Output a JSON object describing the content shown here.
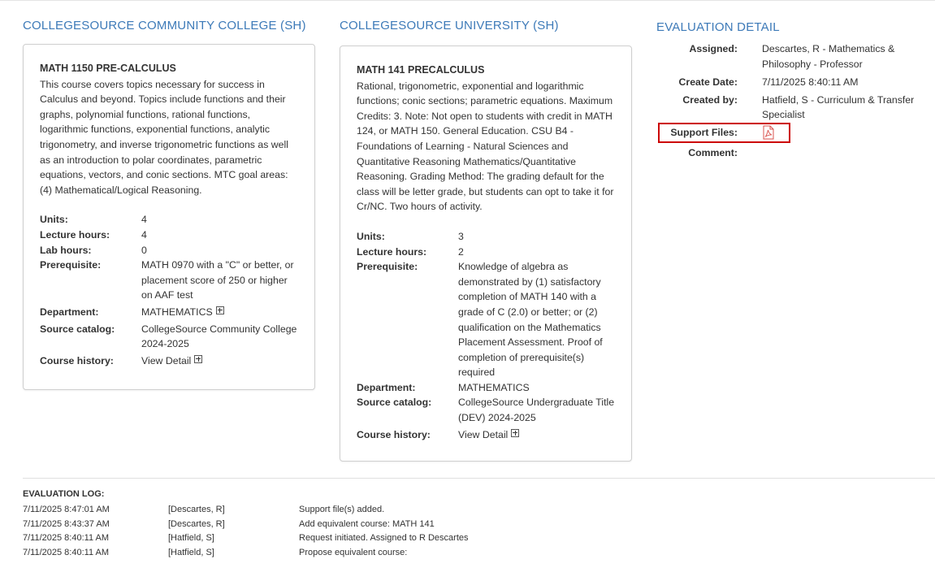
{
  "left_course": {
    "institution": "COLLEGESOURCE COMMUNITY COLLEGE (SH)",
    "title": "MATH 1150 PRE-CALCULUS",
    "description": "This course covers topics necessary for success in Calculus and beyond. Topics include functions and their graphs, polynomial functions, rational functions, logarithmic functions, exponential functions, analytic trigonometry, and inverse trigonometric functions as well as an introduction to polar coordinates, parametric equations, vectors, and conic sections. MTC goal areas: (4) Mathematical/Logical Reasoning.",
    "units_label": "Units:",
    "units": "4",
    "lecture_label": "Lecture hours:",
    "lecture": "4",
    "lab_label": "Lab hours:",
    "lab": "0",
    "prereq_label": "Prerequisite:",
    "prereq": "MATH 0970 with a \"C\" or better, or placement score of 250 or higher on AAF test",
    "dept_label": "Department:",
    "dept": "MATHEMATICS",
    "catalog_label": "Source catalog:",
    "catalog": "CollegeSource Community College 2024-2025",
    "history_label": "Course history:",
    "history": "View Detail"
  },
  "right_course": {
    "institution": "COLLEGESOURCE UNIVERSITY (SH)",
    "title": "MATH 141 PRECALCULUS",
    "description": "Rational, trigonometric, exponential and logarithmic functions; conic sections; parametric equations. Maximum Credits: 3. Note: Not open to students with credit in MATH 124, or MATH 150. General Education. CSU B4 - Foundations of Learning - Natural Sciences and Quantitative Reasoning Mathematics/Quantitative Reasoning. Grading Method: The grading default for the class will be letter grade, but students can opt to take it for Cr/NC. Two hours of activity.",
    "units_label": "Units:",
    "units": "3",
    "lecture_label": "Lecture hours:",
    "lecture": "2",
    "prereq_label": "Prerequisite:",
    "prereq": "Knowledge of algebra as demonstrated by (1) satisfactory completion of MATH 140 with a grade of C (2.0) or better; or (2) qualification on the Mathematics Placement Assessment. Proof of completion of prerequisite(s) required",
    "dept_label": "Department:",
    "dept": "MATHEMATICS",
    "catalog_label": "Source catalog:",
    "catalog": "CollegeSource Undergraduate Title (DEV) 2024-2025",
    "history_label": "Course history:",
    "history": "View Detail"
  },
  "evaluation": {
    "heading": "EVALUATION DETAIL",
    "assigned_label": "Assigned:",
    "assigned": "Descartes, R - Mathematics & Philosophy - Professor",
    "created_date_label": "Create Date:",
    "created_date": "7/11/2025 8:40:11 AM",
    "created_by_label": "Created by:",
    "created_by": "Hatfield, S - Curriculum & Transfer Specialist",
    "support_files_label": "Support Files:",
    "support_file_icon": "pdf-icon",
    "comment_label": "Comment:",
    "comment": "",
    "highlight_color": "#cc0000"
  },
  "log": {
    "heading": "EVALUATION LOG:",
    "entries": [
      {
        "time": "7/11/2025 8:47:01 AM",
        "user": "[Descartes, R]",
        "message": "Support file(s) added."
      },
      {
        "time": "7/11/2025 8:43:37 AM",
        "user": "[Descartes, R]",
        "message": "Add equivalent course: MATH 141"
      },
      {
        "time": "7/11/2025 8:40:11 AM",
        "user": "[Hatfield, S]",
        "message": "Request initiated. Assigned to R Descartes"
      },
      {
        "time": "7/11/2025 8:40:11 AM",
        "user": "[Hatfield, S]",
        "message": "Propose equivalent course:"
      }
    ]
  },
  "colors": {
    "heading": "#3d7ab8",
    "pdf_icon": "#d9534f"
  }
}
